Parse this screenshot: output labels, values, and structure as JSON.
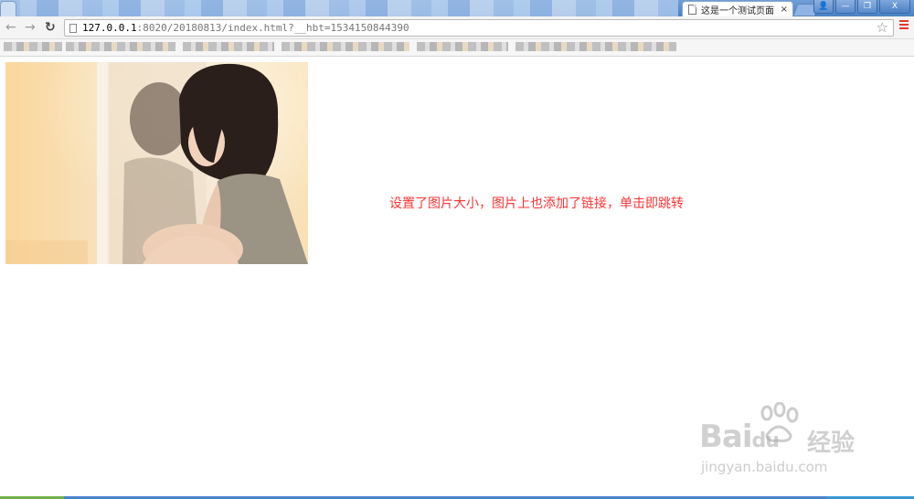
{
  "browser": {
    "active_tab_title": "这是一个测试页面",
    "tab_close_glyph": "×",
    "address": {
      "host": "127.0.0.1",
      "rest": ":8020/20180813/index.html?__hbt=1534150844390"
    },
    "icons": {
      "back": "back-arrow-icon",
      "forward": "forward-arrow-icon",
      "reload": "reload-icon",
      "star": "bookmark-star-icon",
      "menu": "hamburger-menu-icon"
    },
    "window_buttons": {
      "user": "👤",
      "minimize": "—",
      "restore": "❐",
      "close": "X"
    }
  },
  "page": {
    "caption": "设置了图片大小，图片上也添加了链接，单击即跳转",
    "caption_color": "#ff3333"
  },
  "watermark": {
    "brand": "Bai",
    "brand2": "du",
    "brand_cn": "经验",
    "url": "jingyan.baidu.com"
  }
}
